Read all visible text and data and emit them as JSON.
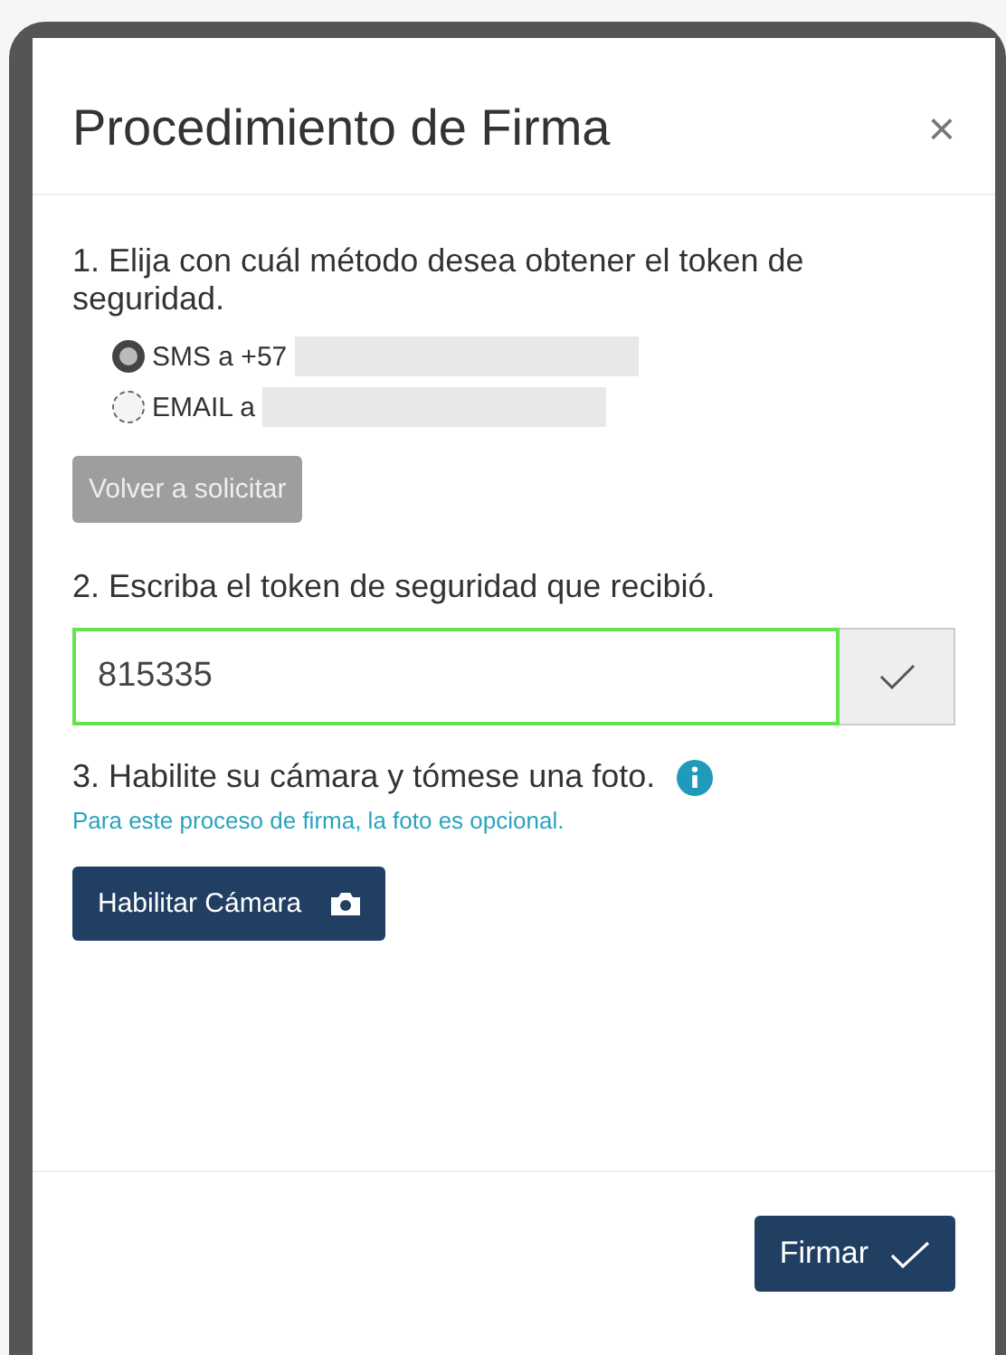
{
  "dialog": {
    "title": "Procedimiento de Firma",
    "close": "×"
  },
  "step1": {
    "label": "1. Elija con cuál método desea obtener el token de seguridad.",
    "options": [
      {
        "label": "SMS a +57",
        "selected": true
      },
      {
        "label": "EMAIL a",
        "selected": false
      }
    ],
    "resend_button": {
      "label": "Volver a solicitar",
      "disabled": true
    }
  },
  "step2": {
    "label": "2. Escriba el token de seguridad que recibió.",
    "token": {
      "value": "815335"
    }
  },
  "step3": {
    "label": "3. Habilite su cámara y tómese una foto.",
    "note": "Para este proceso de firma, la foto es opcional.",
    "camera_button": {
      "label": "Habilitar Cámara"
    }
  },
  "footer": {
    "sign_button": {
      "label": "Firmar"
    }
  }
}
